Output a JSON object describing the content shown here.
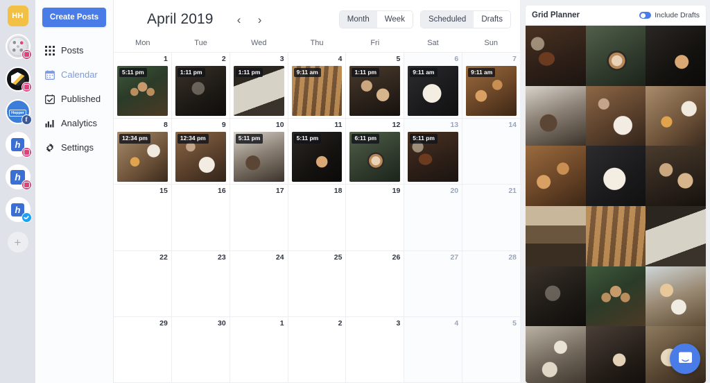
{
  "rail": {
    "user_avatar_initials": "HH",
    "accounts": [
      {
        "name": "account-1",
        "platform": "instagram",
        "badge": "instagram-badge-icon"
      },
      {
        "name": "account-2",
        "platform": "instagram",
        "badge": "instagram-badge-icon"
      },
      {
        "name": "account-3",
        "platform": "facebook",
        "badge": "facebook-badge-icon",
        "logo_text": "Hopper"
      },
      {
        "name": "account-4",
        "platform": "instagram",
        "badge": "instagram-badge-icon",
        "logo_text": "h"
      },
      {
        "name": "account-5",
        "platform": "instagram",
        "badge": "instagram-badge-icon",
        "logo_text": "h"
      },
      {
        "name": "account-6",
        "platform": "twitter",
        "badge": "twitter-badge-icon",
        "logo_text": "h"
      }
    ],
    "add_account_label": "+"
  },
  "nav": {
    "create_button": "Create Posts",
    "items": [
      {
        "label": "Posts",
        "icon": "grid-icon",
        "active": false
      },
      {
        "label": "Calendar",
        "icon": "calendar-icon",
        "active": true
      },
      {
        "label": "Published",
        "icon": "calendar-check-icon",
        "active": false
      },
      {
        "label": "Analytics",
        "icon": "bar-chart-icon",
        "active": false
      },
      {
        "label": "Settings",
        "icon": "gear-icon",
        "active": false
      }
    ]
  },
  "calendar": {
    "title": "April 2019",
    "prev_label": "‹",
    "next_label": "›",
    "view_toggle": [
      {
        "label": "Month",
        "selected": true
      },
      {
        "label": "Week",
        "selected": false
      }
    ],
    "status_toggle": [
      {
        "label": "Scheduled",
        "selected": true
      },
      {
        "label": "Drafts",
        "selected": false
      }
    ],
    "day_headers": [
      "Mon",
      "Tue",
      "Wed",
      "Thu",
      "Fri",
      "Sat",
      "Sun"
    ],
    "weeks": [
      [
        {
          "num": "1",
          "weekend": false,
          "post": {
            "time": "5:11 pm",
            "photo": "ph-14"
          }
        },
        {
          "num": "2",
          "weekend": false,
          "post": {
            "time": "1:11 pm",
            "photo": "ph-13"
          }
        },
        {
          "num": "3",
          "weekend": false,
          "post": {
            "time": "1:11 pm",
            "photo": "ph-12"
          }
        },
        {
          "num": "4",
          "weekend": false,
          "post": {
            "time": "9:11 am",
            "photo": "ph-11"
          }
        },
        {
          "num": "5",
          "weekend": false,
          "post": {
            "time": "1:11 pm",
            "photo": "ph-9"
          }
        },
        {
          "num": "6",
          "weekend": true,
          "post": {
            "time": "9:11 am",
            "photo": "ph-8"
          }
        },
        {
          "num": "7",
          "weekend": true,
          "post": {
            "time": "9:11 am",
            "photo": "ph-7"
          }
        }
      ],
      [
        {
          "num": "8",
          "weekend": false,
          "post": {
            "time": "12:34 pm",
            "photo": "ph-6"
          }
        },
        {
          "num": "9",
          "weekend": false,
          "post": {
            "time": "12:34 pm",
            "photo": "ph-5"
          }
        },
        {
          "num": "10",
          "weekend": false,
          "post": {
            "time": "5:11 pm",
            "photo": "ph-4"
          }
        },
        {
          "num": "11",
          "weekend": false,
          "post": {
            "time": "5:11 pm",
            "photo": "ph-3"
          }
        },
        {
          "num": "12",
          "weekend": false,
          "post": {
            "time": "6:11 pm",
            "photo": "ph-2"
          }
        },
        {
          "num": "13",
          "weekend": true,
          "post": {
            "time": "5:11 pm",
            "photo": "ph-1"
          }
        },
        {
          "num": "14",
          "weekend": true,
          "post": null
        }
      ],
      [
        {
          "num": "15",
          "weekend": false,
          "post": null
        },
        {
          "num": "16",
          "weekend": false,
          "post": null
        },
        {
          "num": "17",
          "weekend": false,
          "post": null
        },
        {
          "num": "18",
          "weekend": false,
          "post": null
        },
        {
          "num": "19",
          "weekend": false,
          "post": null
        },
        {
          "num": "20",
          "weekend": true,
          "post": null
        },
        {
          "num": "21",
          "weekend": true,
          "post": null
        }
      ],
      [
        {
          "num": "22",
          "weekend": false,
          "post": null
        },
        {
          "num": "23",
          "weekend": false,
          "post": null
        },
        {
          "num": "24",
          "weekend": false,
          "post": null
        },
        {
          "num": "25",
          "weekend": false,
          "post": null
        },
        {
          "num": "26",
          "weekend": false,
          "post": null
        },
        {
          "num": "27",
          "weekend": true,
          "post": null
        },
        {
          "num": "28",
          "weekend": true,
          "post": null
        }
      ],
      [
        {
          "num": "29",
          "weekend": false,
          "post": null
        },
        {
          "num": "30",
          "weekend": false,
          "post": null
        },
        {
          "num": "1",
          "weekend": false,
          "post": null
        },
        {
          "num": "2",
          "weekend": false,
          "post": null
        },
        {
          "num": "3",
          "weekend": false,
          "post": null
        },
        {
          "num": "4",
          "weekend": true,
          "post": null
        },
        {
          "num": "5",
          "weekend": true,
          "post": null
        }
      ]
    ]
  },
  "planner": {
    "title": "Grid Planner",
    "include_drafts_label": "Include Drafts",
    "include_drafts_on": true,
    "cells": [
      "ph-1",
      "ph-2",
      "ph-3",
      "ph-4",
      "ph-5",
      "ph-6",
      "ph-7",
      "ph-8",
      "ph-9",
      "ph-10",
      "ph-11",
      "ph-12",
      "ph-13",
      "ph-14",
      "ph-15",
      "ph-16",
      "ph-17",
      "ph-18"
    ]
  },
  "intercom": {
    "icon": "chat-bubble-icon"
  },
  "colors": {
    "accent": "#4a7ce8",
    "avatar": "#f2c044",
    "active_nav": "#7e9ae0",
    "rail_bg": "#dfe2e8",
    "planner_bg": "#eef0f4"
  }
}
